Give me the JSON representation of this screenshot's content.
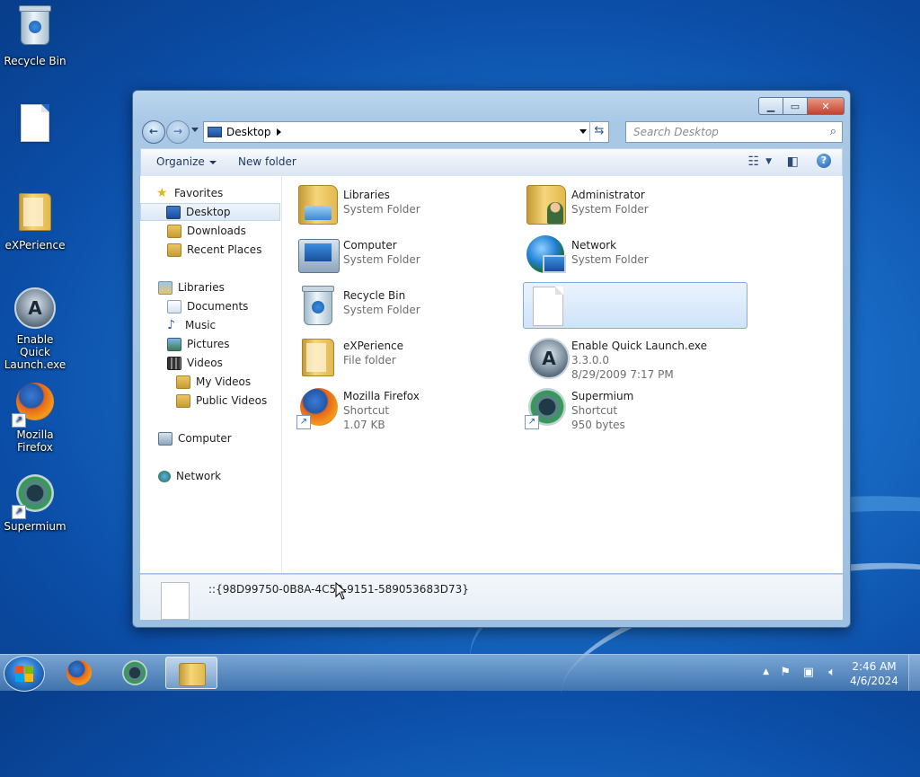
{
  "desktop": {
    "icons": [
      {
        "label": "Recycle Bin"
      },
      {
        "label": ""
      },
      {
        "label": "eXPerience"
      },
      {
        "label": "Enable Quick Launch.exe"
      },
      {
        "label": "Mozilla Firefox"
      },
      {
        "label": "Supermium"
      }
    ]
  },
  "window": {
    "address": {
      "location": "Desktop"
    },
    "search": {
      "placeholder": "Search Desktop"
    },
    "toolbar": {
      "organize": "Organize",
      "new_folder": "New folder"
    },
    "nav": {
      "favorites": "Favorites",
      "desktop": "Desktop",
      "downloads": "Downloads",
      "recent_places": "Recent Places",
      "libraries": "Libraries",
      "documents": "Documents",
      "music": "Music",
      "pictures": "Pictures",
      "videos": "Videos",
      "my_videos": "My Videos",
      "public_videos": "Public Videos",
      "computer": "Computer",
      "network": "Network"
    },
    "items": [
      {
        "name": "Libraries",
        "line1": "System Folder",
        "line2": "",
        "icon": "libraries-folder-icon"
      },
      {
        "name": "Administrator",
        "line1": "System Folder",
        "line2": "",
        "icon": "user-folder-icon"
      },
      {
        "name": "Computer",
        "line1": "System Folder",
        "line2": "",
        "icon": "computer-icon"
      },
      {
        "name": "Network",
        "line1": "System Folder",
        "line2": "",
        "icon": "network-globe-icon"
      },
      {
        "name": "Recycle Bin",
        "line1": "System Folder",
        "line2": "",
        "icon": "recycle-bin-icon"
      },
      {
        "name": "",
        "line1": "",
        "line2": "",
        "icon": "blank-file-icon",
        "selected": true
      },
      {
        "name": "eXPerience",
        "line1": "File folder",
        "line2": "",
        "icon": "folder-icon"
      },
      {
        "name": "Enable Quick Launch.exe",
        "line1": "3.3.0.0",
        "line2": "8/29/2009 7:17 PM",
        "icon": "aimp-icon"
      },
      {
        "name": "Mozilla Firefox",
        "line1": "Shortcut",
        "line2": "1.07 KB",
        "icon": "firefox-icon"
      },
      {
        "name": "Supermium",
        "line1": "Shortcut",
        "line2": "950 bytes",
        "icon": "supermium-icon"
      }
    ],
    "details": {
      "text": "::{98D99750-0B8A-4C59-9151-589053683D73}"
    }
  },
  "taskbar": {
    "clock_time": "2:46 AM",
    "clock_date": "4/6/2024"
  }
}
